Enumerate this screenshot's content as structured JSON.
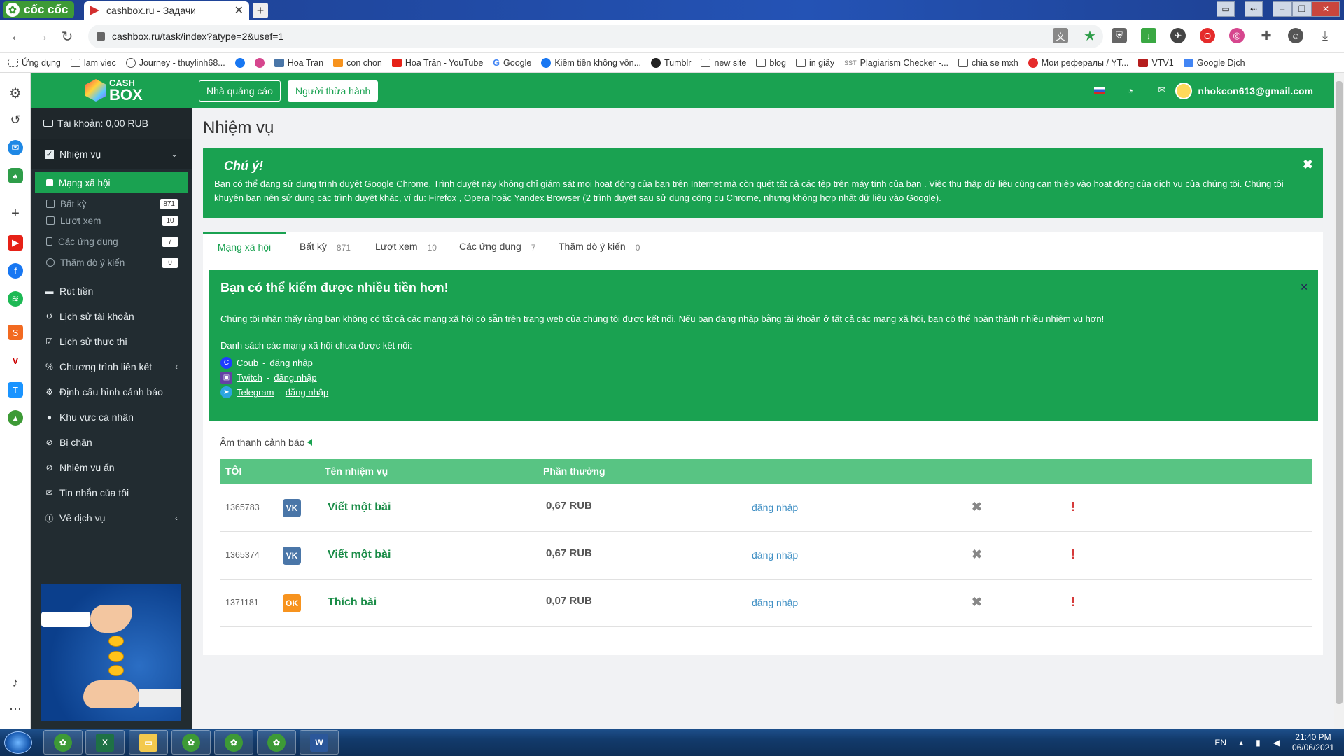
{
  "browser": {
    "brand": "cốc cốc",
    "tab_title": "cashbox.ru - Задачи",
    "url": "cashbox.ru/task/index?atype=2&usef=1",
    "bookmarks": [
      "Ứng dụng",
      "lam viec",
      "Journey - thuylinh68...",
      "Hoa Tran",
      "con chon",
      "Hoa Trần - YouTube",
      "Google",
      "Kiếm tiền không vốn...",
      "Tumblr",
      "new site",
      "blog",
      "in giấy",
      "Plagiarism Checker -...",
      "chia se mxh",
      "Мои рефералы / YT...",
      "VTV1",
      "Google Dịch"
    ]
  },
  "site": {
    "logo_line1": "CASH",
    "logo_line2": "BOX",
    "btn_advertiser": "Nhà quảng cáo",
    "btn_performer": "Người thừa hành",
    "user_email": "nhokcon613@gmail.com"
  },
  "sidebar": {
    "balance": "Tài khoản: 0,00 RUB",
    "tasks": "Nhiệm vụ",
    "subs": [
      {
        "label": "Mạng xã hội",
        "badge": ""
      },
      {
        "label": "Bất kỳ",
        "badge": "871"
      },
      {
        "label": "Lượt xem",
        "badge": "10"
      },
      {
        "label": "Các ứng dụng",
        "badge": "7"
      },
      {
        "label": "Thăm dò ý kiến",
        "badge": "0"
      }
    ],
    "items": [
      "Rút tiền",
      "Lịch sử tài khoản",
      "Lịch sử thực thi",
      "Chương trình liên kết",
      "Định cấu hình cảnh báo",
      "Khu vực cá nhân",
      "Bị chặn",
      "Nhiệm vụ ẩn",
      "Tin nhắn của tôi",
      "Về dịch vụ"
    ]
  },
  "main": {
    "title": "Nhiệm vụ",
    "alert_title": "Chú ý!",
    "alert_t1": "Bạn có thể đang sử dụng trình duyệt Google Chrome. Trình duyệt này không chỉ giám sát mọi hoạt động của bạn trên Internet mà còn ",
    "alert_link": "quét tất cả các tệp trên máy tính của bạn",
    "alert_t2": " . Việc thu thập dữ liệu cũng can thiệp vào hoạt động của dịch vụ của chúng tôi. Chúng tôi khuyên bạn nên sử dụng các trình duyệt khác, ví dụ: ",
    "firefox": "Firefox",
    "comma": " , ",
    "opera": "Opera",
    "or": " hoặc ",
    "yandex": "Yandex",
    "alert_t3": " Browser (2 trình duyệt sau sử dụng công cụ Chrome, nhưng không hợp nhất dữ liệu vào Google).",
    "tabs": [
      {
        "label": "Mạng xã hội",
        "count": ""
      },
      {
        "label": "Bất kỳ",
        "count": "871"
      },
      {
        "label": "Lượt xem",
        "count": "10"
      },
      {
        "label": "Các ứng dụng",
        "count": "7"
      },
      {
        "label": "Thăm dò ý kiến",
        "count": "0"
      }
    ],
    "banner_title": "Bạn có thể kiếm được nhiều tiền hơn!",
    "banner_text": "Chúng tôi nhận thấy rằng bạn không có tất cả các mạng xã hội có sẵn trên trang web của chúng tôi được kết nối. Nếu bạn đăng nhập bằng tài khoản ở tất cả các mạng xã hội, bạn có thể hoàn thành nhiều nhiệm vụ hơn!",
    "list_title": "Danh sách các mạng xã hội chưa được kết nối:",
    "networks": [
      {
        "name": "Coub",
        "sep": " - ",
        "login": "đăng nhập"
      },
      {
        "name": "Twitch",
        "sep": " - ",
        "login": "đăng nhập"
      },
      {
        "name": "Telegram",
        "sep": " - ",
        "login": "đăng nhập"
      }
    ],
    "sound": "Âm thanh cảnh báo",
    "col_id": "TÔI",
    "col_name": "Tên nhiệm vụ",
    "col_reward": "Phần thưởng",
    "rows": [
      {
        "id": "1365783",
        "net": "VK",
        "name": "Viết một bài",
        "reward": "0,67 RUB",
        "login": "đăng nhập",
        "remove": "✖",
        "report": "!"
      },
      {
        "id": "1365374",
        "net": "VK",
        "name": "Viết một bài",
        "reward": "0,67 RUB",
        "login": "đăng nhập",
        "remove": "✖",
        "report": "!"
      },
      {
        "id": "1371181",
        "net": "OK",
        "name": "Thích bài",
        "reward": "0,07 RUB",
        "login": "đăng nhập",
        "remove": "✖",
        "report": "!"
      }
    ]
  },
  "taskbar": {
    "lang": "EN",
    "time": "21:40 PM",
    "date": "06/06/2021"
  },
  "colors": {
    "brand_green": "#1aa251",
    "sidebar_dark": "#222c31",
    "vk_blue": "#4a76a8",
    "ok_orange": "#f7931e"
  }
}
